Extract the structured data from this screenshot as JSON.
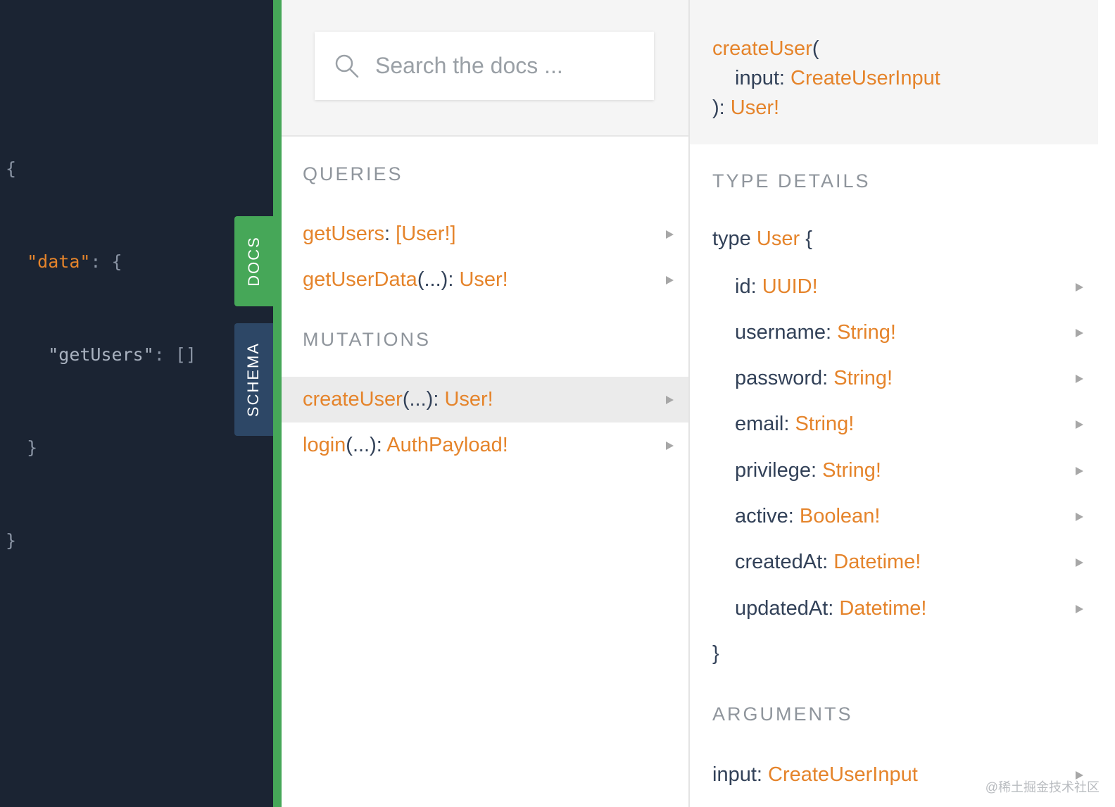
{
  "result": {
    "lines": {
      "l1": "{",
      "l2_key": "\"data\"",
      "l2_rest": ": {",
      "l3_key": "\"getUsers\"",
      "l3_rest": ": []",
      "l4": "  }",
      "l5": "}"
    }
  },
  "side_tabs": {
    "docs": "DOCS",
    "schema": "SCHEMA"
  },
  "docs": {
    "search_placeholder": "Search the docs ...",
    "queries_title": "QUERIES",
    "mutations_title": "MUTATIONS",
    "queries": [
      {
        "name": "getUsers",
        "args": "",
        "type": "[User!]"
      },
      {
        "name": "getUserData",
        "args": "(...)",
        "type": "User!"
      }
    ],
    "mutations": [
      {
        "name": "createUser",
        "args": "(...)",
        "type": "User!",
        "selected": true
      },
      {
        "name": "login",
        "args": "(...)",
        "type": "AuthPayload!"
      }
    ]
  },
  "detail": {
    "signature": {
      "name": "createUser",
      "open": "(",
      "arg_name": "input",
      "arg_type": "CreateUserInput",
      "close": "): ",
      "return_type": "User!"
    },
    "type_details_title": "TYPE DETAILS",
    "type_keyword": "type",
    "type_name": "User",
    "open_brace": "{",
    "close_brace": "}",
    "fields": [
      {
        "name": "id",
        "type": "UUID!"
      },
      {
        "name": "username",
        "type": "String!"
      },
      {
        "name": "password",
        "type": "String!"
      },
      {
        "name": "email",
        "type": "String!"
      },
      {
        "name": "privilege",
        "type": "String!"
      },
      {
        "name": "active",
        "type": "Boolean!"
      },
      {
        "name": "createdAt",
        "type": "Datetime!"
      },
      {
        "name": "updatedAt",
        "type": "Datetime!"
      }
    ],
    "arguments_title": "ARGUMENTS",
    "arguments": [
      {
        "name": "input",
        "type": "CreateUserInput"
      }
    ]
  },
  "watermark": "@稀土掘金技术社区",
  "colors": {
    "accent_orange": "#e5842b",
    "text_dark": "#324158",
    "sidebar_bg": "#1b2433",
    "docs_tab_green": "#46a758",
    "schema_tab_blue": "#2d4766"
  },
  "icons": {
    "search": "search-icon",
    "expand": "chevron-right-icon"
  }
}
